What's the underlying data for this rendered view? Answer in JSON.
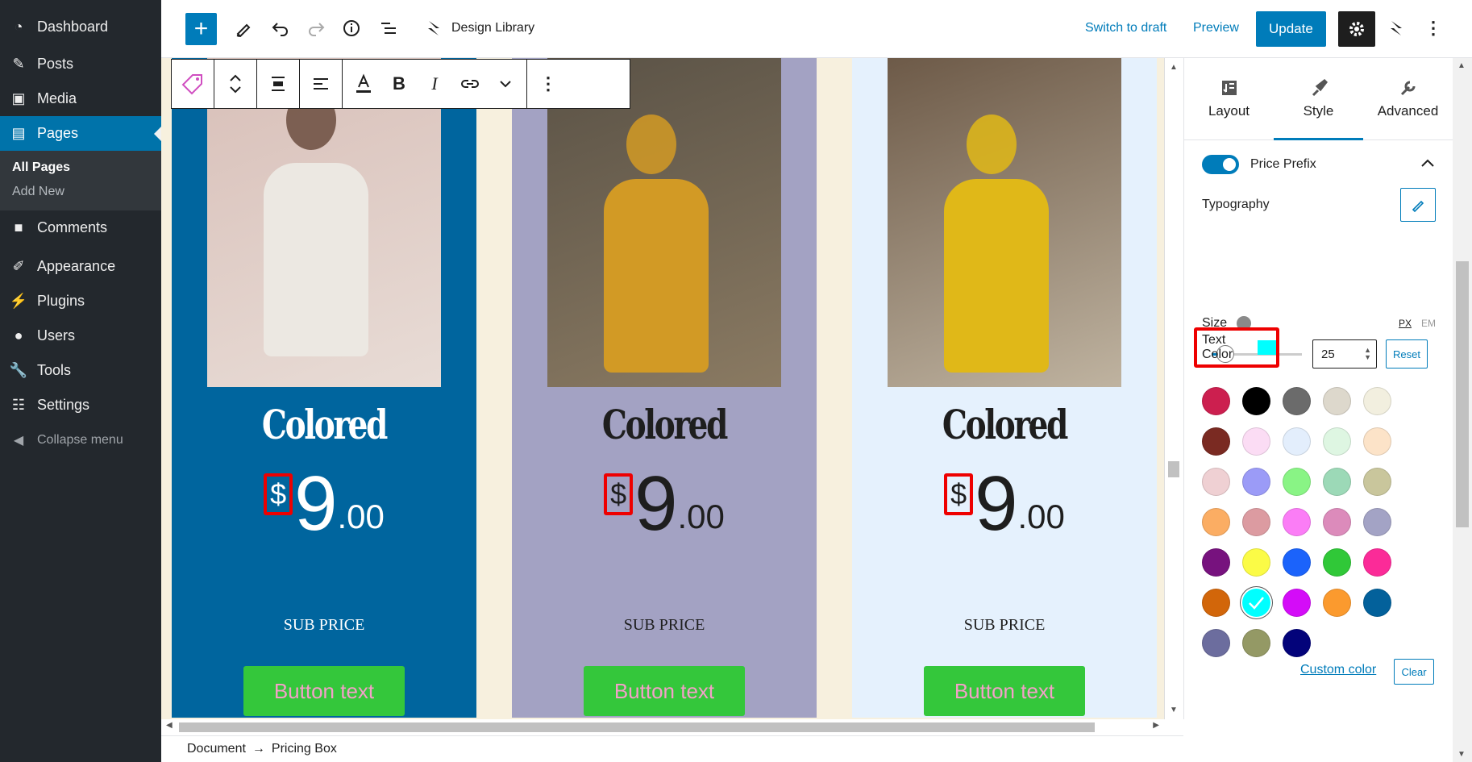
{
  "admin_menu": {
    "items": [
      {
        "id": "dashboard",
        "label": "Dashboard",
        "icon": "gauge-icon"
      },
      {
        "id": "posts",
        "label": "Posts",
        "icon": "pin-icon"
      },
      {
        "id": "media",
        "label": "Media",
        "icon": "media-icon"
      },
      {
        "id": "pages",
        "label": "Pages",
        "icon": "pages-icon"
      },
      {
        "id": "comments",
        "label": "Comments",
        "icon": "comment-icon"
      },
      {
        "id": "appearance",
        "label": "Appearance",
        "icon": "brush-icon"
      },
      {
        "id": "plugins",
        "label": "Plugins",
        "icon": "plug-icon"
      },
      {
        "id": "users",
        "label": "Users",
        "icon": "user-icon"
      },
      {
        "id": "tools",
        "label": "Tools",
        "icon": "wrench-icon"
      },
      {
        "id": "settings",
        "label": "Settings",
        "icon": "sliders-icon"
      }
    ],
    "submenu": [
      "All Pages",
      "Add New"
    ],
    "collapse": "Collapse menu"
  },
  "topbar": {
    "design_library": "Design Library",
    "switch_draft": "Switch to draft",
    "preview": "Preview",
    "update": "Update"
  },
  "columns": [
    {
      "bg": "#00659e",
      "fg": "#ffffff",
      "title": "Colored",
      "prefix": "$",
      "amount": "9",
      "cents": ".00",
      "sub": "SUB PRICE",
      "button": "Button text"
    },
    {
      "bg": "#a3a2c3",
      "fg": "#1e1e1e",
      "title": "Colored",
      "prefix": "$",
      "amount": "9",
      "cents": ".00",
      "sub": "SUB PRICE",
      "button": "Button text"
    },
    {
      "bg": "#e5f1fd",
      "fg": "#1e1e1e",
      "title": "Colored",
      "prefix": "$",
      "amount": "9",
      "cents": ".00",
      "sub": "SUB PRICE",
      "button": "Button text"
    }
  ],
  "sidebar": {
    "tabs": [
      "Layout",
      "Style",
      "Advanced"
    ],
    "price_prefix": "Price Prefix",
    "typography": "Typography",
    "size": "Size",
    "unit_px": "PX",
    "unit_em": "EM",
    "size_value": "25",
    "reset": "Reset",
    "text_color": "Text Color",
    "text_color_value": "#00ffff",
    "custom_color": "Custom color",
    "clear": "Clear",
    "palette": [
      "#cc1f4f",
      "#000000",
      "#6b6b6b",
      "#ddd8cc",
      "#f2efdf",
      "#7a2a22",
      "#fbdcf4",
      "#e3eefc",
      "#def6e2",
      "#fce3c8",
      "#efd0d3",
      "#9b9bf7",
      "#89f485",
      "#9cd9b7",
      "#c9c69c",
      "#fbad63",
      "#dc9ba1",
      "#fb7df6",
      "#dc8bbb",
      "#a3a3c5",
      "#77127e",
      "#fbfb46",
      "#1b63fb",
      "#30c838",
      "#fb2b98",
      "#d2660a",
      "#00ffff",
      "#d40cf8",
      "#fb9a2e",
      "#03619b",
      "#6c6d9e",
      "#949965",
      "#03037a"
    ]
  },
  "footer": {
    "crumb1": "Document",
    "arrow": "→",
    "crumb2": "Pricing Box"
  }
}
